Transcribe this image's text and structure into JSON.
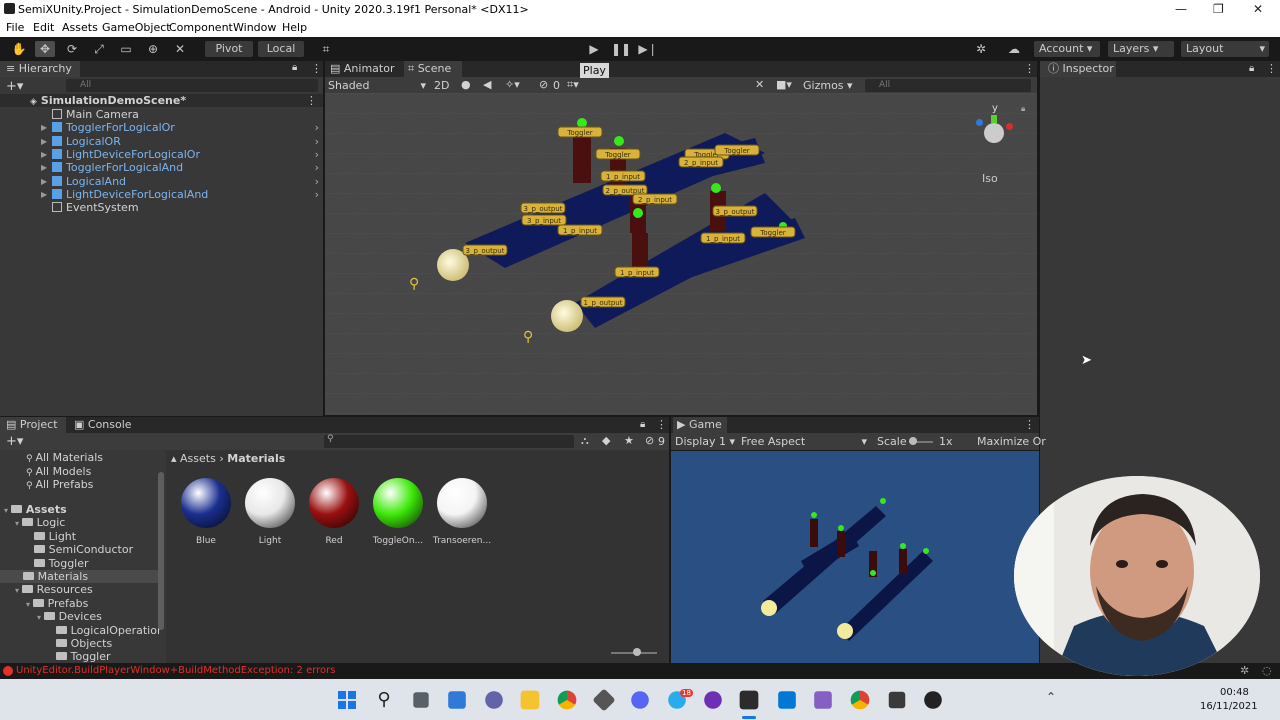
{
  "window": {
    "title": "SemiXUnity.Project - SimulationDemoScene - Android - Unity 2020.3.19f1 Personal* <DX11>",
    "controls": [
      "—",
      "❐",
      "✕"
    ]
  },
  "menu": [
    "File",
    "Edit",
    "Assets",
    "GameObject",
    "Component",
    "Window",
    "Help"
  ],
  "toolbar": {
    "pivot": "Pivot",
    "local": "Local",
    "play_tooltip": "Play",
    "account": "Account",
    "layers": "Layers",
    "layout": "Layout"
  },
  "hierarchy": {
    "tab": "Hierarchy",
    "search_placeholder": "All",
    "scene": "SimulationDemoScene*",
    "items": [
      {
        "label": "Main Camera",
        "prefab": false
      },
      {
        "label": "TogglerForLogicalOr",
        "prefab": true
      },
      {
        "label": "LogicalOR",
        "prefab": true
      },
      {
        "label": "LightDeviceForLogicalOr",
        "prefab": true
      },
      {
        "label": "TogglerForLogicalAnd",
        "prefab": true
      },
      {
        "label": "LogicalAnd",
        "prefab": true
      },
      {
        "label": "LightDeviceForLogicalAnd",
        "prefab": true
      },
      {
        "label": "EventSystem",
        "prefab": false
      }
    ]
  },
  "scene_view": {
    "tabs": [
      "Animator",
      "Scene"
    ],
    "shading": "Shaded",
    "mode_2d": "2D",
    "hidden_count": "0",
    "gizmos": "Gizmos",
    "search_placeholder": "All",
    "projection": "Iso",
    "axis_y": "y",
    "labels": [
      "Toggler",
      "Toggler",
      "Toggler",
      "Toggler",
      "Toggler",
      "2_p_input",
      "1_p_input",
      "2_p_output",
      "3_p_output",
      "3_p_input",
      "2_p_input",
      "1_p_input",
      "3_p_output",
      "1_p_input",
      "1_p_input",
      "1_p_output",
      "3_p_output"
    ]
  },
  "inspector": {
    "tab": "Inspector"
  },
  "project": {
    "tabs": [
      "Project",
      "Console"
    ],
    "search_placeholder": "",
    "favorites": [
      "All Materials",
      "All Models",
      "All Prefabs"
    ],
    "tree": [
      {
        "label": "Assets",
        "depth": 0,
        "bold": true
      },
      {
        "label": "Logic",
        "depth": 1
      },
      {
        "label": "Light",
        "depth": 2
      },
      {
        "label": "SemiConductor",
        "depth": 2
      },
      {
        "label": "Toggler",
        "depth": 2
      },
      {
        "label": "Materials",
        "depth": 1,
        "selected": true
      },
      {
        "label": "Resources",
        "depth": 1
      },
      {
        "label": "Prefabs",
        "depth": 2
      },
      {
        "label": "Devices",
        "depth": 3
      },
      {
        "label": "LogicalOperatior",
        "depth": 4
      },
      {
        "label": "Objects",
        "depth": 4
      },
      {
        "label": "Toggler",
        "depth": 4
      }
    ],
    "breadcrumb": [
      "Assets",
      "Materials"
    ],
    "hidden_count": "9",
    "assets": [
      {
        "name": "Blue",
        "color": "#1a2f8f"
      },
      {
        "name": "Light",
        "color": "#e8e8e8"
      },
      {
        "name": "Red",
        "color": "#9a1010"
      },
      {
        "name": "ToggleOn...",
        "color": "#3eea0a"
      },
      {
        "name": "Transoeren...",
        "color": "#f4f4f4"
      }
    ]
  },
  "game": {
    "tab": "Game",
    "display": "Display 1",
    "aspect": "Free Aspect",
    "scale_label": "Scale",
    "scale_value": "1x",
    "maximize": "Maximize Or"
  },
  "status": {
    "error": "UnityEditor.BuildPlayerWindow+BuildMethodException: 2 errors"
  },
  "taskbar": {
    "time": "00:48",
    "date": "16/11/2021",
    "badge": "18"
  }
}
